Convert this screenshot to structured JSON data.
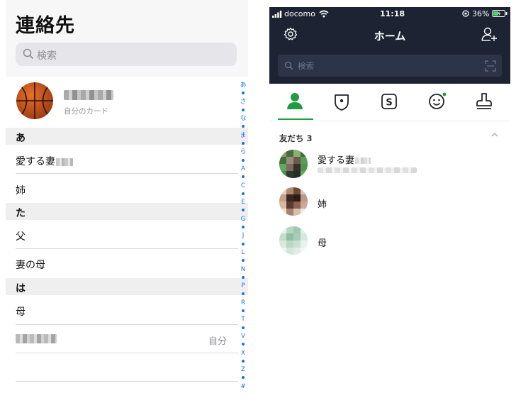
{
  "contacts_app": {
    "title": "連絡先",
    "search_placeholder": "検索",
    "my_card_label": "自分のカード",
    "sections": [
      {
        "letter": "あ",
        "contacts": [
          "愛する妻",
          "姉"
        ]
      },
      {
        "letter": "た",
        "contacts": [
          "父",
          "妻の母"
        ]
      },
      {
        "letter": "は",
        "contacts": [
          "母"
        ]
      }
    ],
    "me_tag": "自分",
    "index_letters": [
      "あ",
      "さ",
      "な",
      "ま",
      "ら",
      "A",
      "C",
      "E",
      "G",
      "J",
      "L",
      "N",
      "P",
      "R",
      "T",
      "V",
      "X",
      "Z",
      "#"
    ]
  },
  "line_app": {
    "status_bar": {
      "carrier": "docomo",
      "time": "11:18",
      "battery": "36%"
    },
    "title": "ホーム",
    "search_placeholder": "検索",
    "tabs": [
      "friends-icon",
      "badge-shield-icon",
      "service-s-icon",
      "smiley-icon",
      "stamp-icon"
    ],
    "friends_section": {
      "title": "友だち 3",
      "friends": [
        {
          "name": "愛する妻"
        },
        {
          "name": "姉"
        },
        {
          "name": "母"
        }
      ]
    },
    "accent_color": "#1f9c41",
    "header_color": "#1e2334"
  }
}
